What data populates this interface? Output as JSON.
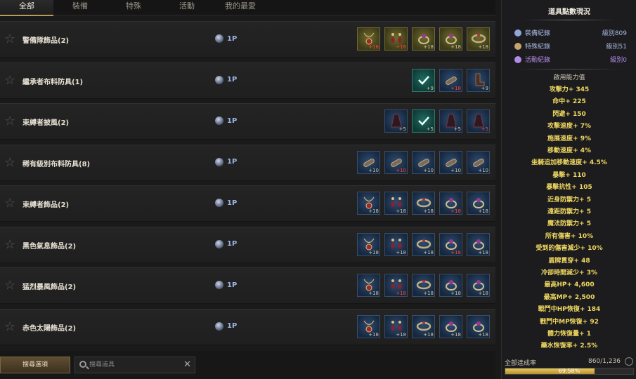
{
  "tabs": [
    "全部",
    "裝備",
    "特殊",
    "活動",
    "我的最愛"
  ],
  "active_tab": 0,
  "rows": [
    {
      "title": "警備隊飾品(2)",
      "points": "1P",
      "items": [
        {
          "kind": "necklace",
          "lvl": "+18",
          "red": true,
          "bg": "gold"
        },
        {
          "kind": "earring",
          "lvl": "+18",
          "red": true,
          "bg": "gold"
        },
        {
          "kind": "ring",
          "lvl": "+18",
          "red": false,
          "bg": "gold"
        },
        {
          "kind": "ring",
          "lvl": "+18",
          "red": false,
          "bg": "gold"
        },
        {
          "kind": "bracelet",
          "lvl": "+18",
          "red": false,
          "bg": "gold"
        }
      ]
    },
    {
      "title": "繼承者布料防具(1)",
      "points": "1P",
      "items": [
        {
          "kind": "check",
          "lvl": "+9",
          "red": false,
          "bg": "teal"
        },
        {
          "kind": "glove",
          "lvl": "+18",
          "red": true,
          "bg": "blue"
        },
        {
          "kind": "boots",
          "lvl": "+9",
          "red": false,
          "bg": "blue"
        }
      ]
    },
    {
      "title": "束縛者披風(2)",
      "points": "1P",
      "items": [
        {
          "kind": "cloak",
          "lvl": "+5",
          "red": false,
          "bg": "blue"
        },
        {
          "kind": "check",
          "lvl": "+5",
          "red": false,
          "bg": "teal"
        },
        {
          "kind": "cloak",
          "lvl": "+5",
          "red": false,
          "bg": "blue"
        },
        {
          "kind": "cloak",
          "lvl": "+5",
          "red": true,
          "bg": "blue"
        }
      ]
    },
    {
      "title": "稀有級別布料防具(8)",
      "points": "1P",
      "items": [
        {
          "kind": "glove",
          "lvl": "+10",
          "red": false,
          "bg": "blue"
        },
        {
          "kind": "glove",
          "lvl": "+10",
          "red": true,
          "bg": "blue"
        },
        {
          "kind": "glove",
          "lvl": "+10",
          "red": false,
          "bg": "blue"
        },
        {
          "kind": "glove",
          "lvl": "+10",
          "red": false,
          "bg": "blue"
        },
        {
          "kind": "glove",
          "lvl": "+10",
          "red": false,
          "bg": "blue"
        }
      ]
    },
    {
      "title": "束縛者飾品(2)",
      "points": "1P",
      "items": [
        {
          "kind": "necklace",
          "lvl": "+18",
          "red": false,
          "bg": "blue"
        },
        {
          "kind": "earring",
          "lvl": "+18",
          "red": false,
          "bg": "blue"
        },
        {
          "kind": "bracelet",
          "lvl": "+18",
          "red": false,
          "bg": "blue"
        },
        {
          "kind": "ring",
          "lvl": "+18",
          "red": true,
          "bg": "blue"
        },
        {
          "kind": "ring",
          "lvl": "+18",
          "red": false,
          "bg": "blue"
        }
      ]
    },
    {
      "title": "黑色氣息飾品(2)",
      "points": "1P",
      "items": [
        {
          "kind": "necklace",
          "lvl": "+18",
          "red": false,
          "bg": "blue"
        },
        {
          "kind": "earring",
          "lvl": "+18",
          "red": false,
          "bg": "blue"
        },
        {
          "kind": "bracelet",
          "lvl": "+18",
          "red": false,
          "bg": "blue"
        },
        {
          "kind": "ring",
          "lvl": "+18",
          "red": true,
          "bg": "blue"
        },
        {
          "kind": "ring",
          "lvl": "+18",
          "red": false,
          "bg": "blue"
        }
      ]
    },
    {
      "title": "猛烈暴風飾品(2)",
      "points": "1P",
      "items": [
        {
          "kind": "necklace",
          "lvl": "+18",
          "red": false,
          "bg": "blue"
        },
        {
          "kind": "earring",
          "lvl": "+18",
          "red": true,
          "bg": "blue"
        },
        {
          "kind": "bracelet",
          "lvl": "+18",
          "red": false,
          "bg": "blue"
        },
        {
          "kind": "ring",
          "lvl": "+18",
          "red": false,
          "bg": "blue"
        },
        {
          "kind": "ring",
          "lvl": "+18",
          "red": false,
          "bg": "blue"
        }
      ]
    },
    {
      "title": "赤色太陽飾品(2)",
      "points": "1P",
      "items": [
        {
          "kind": "necklace",
          "lvl": "+18",
          "red": false,
          "bg": "blue"
        },
        {
          "kind": "earring",
          "lvl": "+18",
          "red": false,
          "bg": "blue"
        },
        {
          "kind": "bracelet",
          "lvl": "+18",
          "red": false,
          "bg": "blue"
        },
        {
          "kind": "ring",
          "lvl": "+18",
          "red": false,
          "bg": "blue"
        },
        {
          "kind": "ring",
          "lvl": "+18",
          "red": false,
          "bg": "blue"
        }
      ]
    }
  ],
  "bottom": {
    "search_option_label": "搜尋選項",
    "search_placeholder": "搜尋道具"
  },
  "panel": {
    "title": "道具點數現況",
    "records": [
      {
        "name": "裝備紀錄",
        "value": "級別809",
        "icon_color": "#8fa6d8"
      },
      {
        "name": "特殊紀錄",
        "value": "級別51",
        "icon_color": "#c9a46a"
      },
      {
        "name": "活動紀錄",
        "value": "級別0",
        "icon_color": "#b48ae8"
      }
    ],
    "ability_title": "啟用能力值",
    "stats": [
      "攻擊力+ 345",
      "命中+ 225",
      "閃避+ 150",
      "攻擊速度+ 7%",
      "施展速度+ 9%",
      "移動速度+ 4%",
      "坐騎追加移動速度+ 4.5%",
      "暴擊+ 110",
      "暴擊抗性+ 105",
      "近身防禦力+ 5",
      "遠距防禦力+ 5",
      "魔法防禦力+ 5",
      "所有傷害+ 10%",
      "受到的傷害減少+ 10%",
      "盾牌貫穿+ 48",
      "冷卻時間減少+ 3%",
      "最高HP+ 4,600",
      "最高MP+ 2,500",
      "戰鬥中HP恢復+ 184",
      "戰鬥中MP恢復+ 92",
      "體力恢復量+ 1",
      "藥水恢復率+ 2.5%"
    ],
    "total_label": "全部達成率",
    "total_value": "860/1,236",
    "progress_text": "69.58%",
    "progress_fraction": 0.6958
  }
}
